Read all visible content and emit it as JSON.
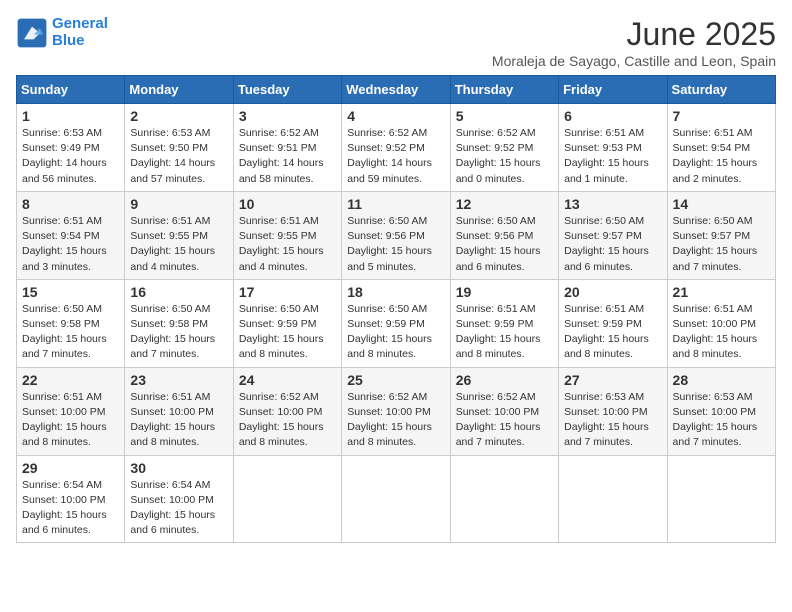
{
  "logo": {
    "line1": "General",
    "line2": "Blue"
  },
  "title": "June 2025",
  "location": "Moraleja de Sayago, Castille and Leon, Spain",
  "days_of_week": [
    "Sunday",
    "Monday",
    "Tuesday",
    "Wednesday",
    "Thursday",
    "Friday",
    "Saturday"
  ],
  "weeks": [
    [
      {
        "day": "1",
        "info": "Sunrise: 6:53 AM\nSunset: 9:49 PM\nDaylight: 14 hours\nand 56 minutes."
      },
      {
        "day": "2",
        "info": "Sunrise: 6:53 AM\nSunset: 9:50 PM\nDaylight: 14 hours\nand 57 minutes."
      },
      {
        "day": "3",
        "info": "Sunrise: 6:52 AM\nSunset: 9:51 PM\nDaylight: 14 hours\nand 58 minutes."
      },
      {
        "day": "4",
        "info": "Sunrise: 6:52 AM\nSunset: 9:52 PM\nDaylight: 14 hours\nand 59 minutes."
      },
      {
        "day": "5",
        "info": "Sunrise: 6:52 AM\nSunset: 9:52 PM\nDaylight: 15 hours\nand 0 minutes."
      },
      {
        "day": "6",
        "info": "Sunrise: 6:51 AM\nSunset: 9:53 PM\nDaylight: 15 hours\nand 1 minute."
      },
      {
        "day": "7",
        "info": "Sunrise: 6:51 AM\nSunset: 9:54 PM\nDaylight: 15 hours\nand 2 minutes."
      }
    ],
    [
      {
        "day": "8",
        "info": "Sunrise: 6:51 AM\nSunset: 9:54 PM\nDaylight: 15 hours\nand 3 minutes."
      },
      {
        "day": "9",
        "info": "Sunrise: 6:51 AM\nSunset: 9:55 PM\nDaylight: 15 hours\nand 4 minutes."
      },
      {
        "day": "10",
        "info": "Sunrise: 6:51 AM\nSunset: 9:55 PM\nDaylight: 15 hours\nand 4 minutes."
      },
      {
        "day": "11",
        "info": "Sunrise: 6:50 AM\nSunset: 9:56 PM\nDaylight: 15 hours\nand 5 minutes."
      },
      {
        "day": "12",
        "info": "Sunrise: 6:50 AM\nSunset: 9:56 PM\nDaylight: 15 hours\nand 6 minutes."
      },
      {
        "day": "13",
        "info": "Sunrise: 6:50 AM\nSunset: 9:57 PM\nDaylight: 15 hours\nand 6 minutes."
      },
      {
        "day": "14",
        "info": "Sunrise: 6:50 AM\nSunset: 9:57 PM\nDaylight: 15 hours\nand 7 minutes."
      }
    ],
    [
      {
        "day": "15",
        "info": "Sunrise: 6:50 AM\nSunset: 9:58 PM\nDaylight: 15 hours\nand 7 minutes."
      },
      {
        "day": "16",
        "info": "Sunrise: 6:50 AM\nSunset: 9:58 PM\nDaylight: 15 hours\nand 7 minutes."
      },
      {
        "day": "17",
        "info": "Sunrise: 6:50 AM\nSunset: 9:59 PM\nDaylight: 15 hours\nand 8 minutes."
      },
      {
        "day": "18",
        "info": "Sunrise: 6:50 AM\nSunset: 9:59 PM\nDaylight: 15 hours\nand 8 minutes."
      },
      {
        "day": "19",
        "info": "Sunrise: 6:51 AM\nSunset: 9:59 PM\nDaylight: 15 hours\nand 8 minutes."
      },
      {
        "day": "20",
        "info": "Sunrise: 6:51 AM\nSunset: 9:59 PM\nDaylight: 15 hours\nand 8 minutes."
      },
      {
        "day": "21",
        "info": "Sunrise: 6:51 AM\nSunset: 10:00 PM\nDaylight: 15 hours\nand 8 minutes."
      }
    ],
    [
      {
        "day": "22",
        "info": "Sunrise: 6:51 AM\nSunset: 10:00 PM\nDaylight: 15 hours\nand 8 minutes."
      },
      {
        "day": "23",
        "info": "Sunrise: 6:51 AM\nSunset: 10:00 PM\nDaylight: 15 hours\nand 8 minutes."
      },
      {
        "day": "24",
        "info": "Sunrise: 6:52 AM\nSunset: 10:00 PM\nDaylight: 15 hours\nand 8 minutes."
      },
      {
        "day": "25",
        "info": "Sunrise: 6:52 AM\nSunset: 10:00 PM\nDaylight: 15 hours\nand 8 minutes."
      },
      {
        "day": "26",
        "info": "Sunrise: 6:52 AM\nSunset: 10:00 PM\nDaylight: 15 hours\nand 7 minutes."
      },
      {
        "day": "27",
        "info": "Sunrise: 6:53 AM\nSunset: 10:00 PM\nDaylight: 15 hours\nand 7 minutes."
      },
      {
        "day": "28",
        "info": "Sunrise: 6:53 AM\nSunset: 10:00 PM\nDaylight: 15 hours\nand 7 minutes."
      }
    ],
    [
      {
        "day": "29",
        "info": "Sunrise: 6:54 AM\nSunset: 10:00 PM\nDaylight: 15 hours\nand 6 minutes."
      },
      {
        "day": "30",
        "info": "Sunrise: 6:54 AM\nSunset: 10:00 PM\nDaylight: 15 hours\nand 6 minutes."
      },
      {
        "day": "",
        "info": ""
      },
      {
        "day": "",
        "info": ""
      },
      {
        "day": "",
        "info": ""
      },
      {
        "day": "",
        "info": ""
      },
      {
        "day": "",
        "info": ""
      }
    ]
  ]
}
